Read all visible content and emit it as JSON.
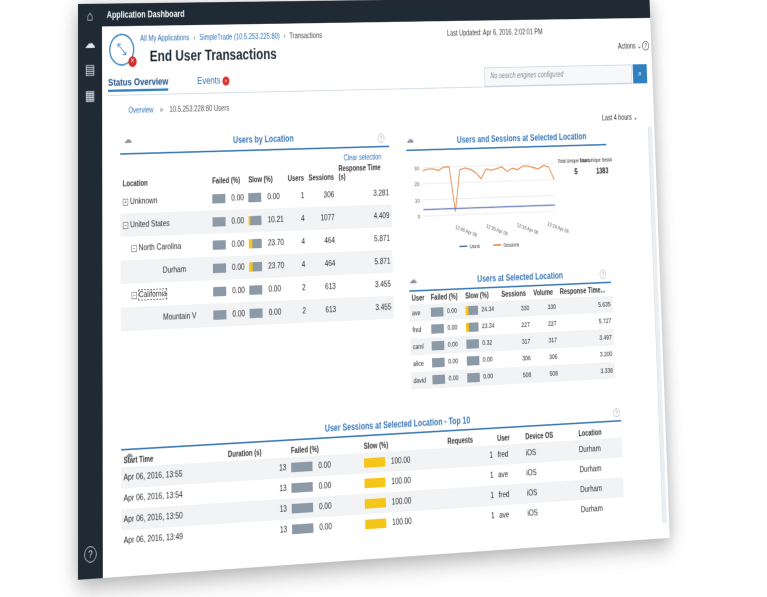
{
  "app": {
    "title": "Application Dashboard"
  },
  "nav": [
    {
      "icon": "home-icon",
      "glyph": "⌂"
    },
    {
      "icon": "cloud-check-icon",
      "glyph": "☁"
    },
    {
      "icon": "document-icon",
      "glyph": "▤"
    },
    {
      "icon": "calendar-grid-icon",
      "glyph": "▦"
    }
  ],
  "help_glyph": "?",
  "header": {
    "breadcrumb": [
      "All My Applications",
      "SimpleTrade (10.5.253.225:80)",
      "Transactions"
    ],
    "breadcrumb_sep": "›",
    "title": "End User Transactions",
    "last_updated": "Last Updated: Apr 6, 2016, 2:02:01 PM",
    "actions": "Actions ⌄"
  },
  "tabs": [
    {
      "label": "Status Overview",
      "active": true
    },
    {
      "label": "Events",
      "badge": "×"
    }
  ],
  "search": {
    "placeholder": "No search engines configured"
  },
  "overview": {
    "link": "Overview",
    "sep": "»",
    "current": "10.5.253.228:80 Users"
  },
  "time_range": "Last 4 hours ⌄",
  "users_by_location": {
    "title": "Users by Location",
    "clear": "Clear selection",
    "columns": [
      "Location",
      "Failed (%)",
      "Slow (%)",
      "Users",
      "Sessions",
      "Response Time (s)"
    ],
    "rows": [
      {
        "name": "Unknown",
        "tree": "+",
        "indent": 0,
        "failed": "0.00",
        "slow": "0.00",
        "slow_frac": 0,
        "users": "1",
        "sessions": "306",
        "resp": "3.281",
        "dotted": false
      },
      {
        "name": "United States",
        "tree": "−",
        "indent": 0,
        "failed": "0.00",
        "slow": "10.21",
        "slow_frac": 0.1021,
        "users": "4",
        "sessions": "1077",
        "resp": "4.409",
        "dotted": false
      },
      {
        "name": "North Carolina",
        "tree": "−",
        "indent": 1,
        "failed": "0.00",
        "slow": "23.70",
        "slow_frac": 0.237,
        "users": "4",
        "sessions": "464",
        "resp": "5.871",
        "dotted": false
      },
      {
        "name": "Durham",
        "tree": "",
        "indent": 2,
        "failed": "0.00",
        "slow": "23.70",
        "slow_frac": 0.237,
        "users": "4",
        "sessions": "464",
        "resp": "5.871",
        "dotted": false
      },
      {
        "name": "California",
        "tree": "−",
        "indent": 1,
        "failed": "0.00",
        "slow": "0.00",
        "slow_frac": 0,
        "users": "2",
        "sessions": "613",
        "resp": "3.455",
        "dotted": true
      },
      {
        "name": "Mountain V",
        "tree": "",
        "indent": 2,
        "failed": "0.00",
        "slow": "0.00",
        "slow_frac": 0,
        "users": "2",
        "sessions": "613",
        "resp": "3.455",
        "dotted": false
      }
    ]
  },
  "users_sessions_chart": {
    "title": "Users and Sessions at Selected Location",
    "stat_users_label": "Total Unique Users",
    "stat_users_value": "5",
    "stat_sessions_label": "Total Unique Sessions",
    "stat_sessions_value": "1383",
    "legend": [
      "Users",
      "Sessions"
    ]
  },
  "chart_data": {
    "type": "line",
    "x": [
      "12:40",
      "12:44",
      "12:48",
      "12:52",
      "12:56",
      "13:00",
      "13:04",
      "13:08",
      "13:12",
      "13:16",
      "13:20",
      "13:24",
      "13:28",
      "13:32",
      "13:36",
      "13:40",
      "13:44",
      "13:48",
      "13:52",
      "13:56",
      "14:00",
      "14:04",
      "14:08",
      "14:12",
      "14:16",
      "14:20"
    ],
    "xticks": [
      "12:45 Apr 06",
      "12:30 Apr 06",
      "12:15 Apr 06",
      "12:16 Apr 06"
    ],
    "yticks": [
      "30",
      "20",
      "10",
      "0"
    ],
    "ylim": [
      0,
      35
    ],
    "series": [
      {
        "name": "Sessions",
        "color": "#e8803a",
        "values": [
          28,
          29,
          29,
          28,
          30,
          30,
          2,
          28,
          29,
          28,
          26,
          22,
          28,
          27,
          28,
          29,
          26,
          28,
          27,
          29,
          29,
          28,
          27,
          29,
          28,
          20
        ]
      },
      {
        "name": "Users",
        "color": "#5b6fb4",
        "values": [
          4,
          4,
          4,
          4,
          4,
          4,
          4,
          4,
          4,
          4,
          4,
          4,
          4,
          4,
          4,
          4,
          4,
          4,
          4,
          4,
          4,
          4,
          4,
          4,
          4,
          4
        ]
      }
    ]
  },
  "users_at_location": {
    "title": "Users at Selected Location",
    "columns": [
      "User",
      "Failed (%)",
      "Slow (%)",
      "Sessions",
      "Volume",
      "Response Time..."
    ],
    "rows": [
      {
        "user": "ave",
        "failed": "0.00",
        "slow": "24.34",
        "slow_frac": 0.2434,
        "sessions": "330",
        "volume": "330",
        "resp": "5.635"
      },
      {
        "user": "fred",
        "failed": "0.00",
        "slow": "23.34",
        "slow_frac": 0.2334,
        "sessions": "227",
        "volume": "227",
        "resp": "5.727"
      },
      {
        "user": "caml",
        "failed": "0.00",
        "slow": "0.32",
        "slow_frac": 0.0032,
        "sessions": "317",
        "volume": "317",
        "resp": "3.497"
      },
      {
        "user": "alice",
        "failed": "0.00",
        "slow": "0.00",
        "slow_frac": 0,
        "sessions": "306",
        "volume": "306",
        "resp": "3.200"
      },
      {
        "user": "david",
        "failed": "0.00",
        "slow": "0.00",
        "slow_frac": 0,
        "sessions": "508",
        "volume": "508",
        "resp": "3.338"
      }
    ]
  },
  "top_sessions": {
    "title": "User Sessions at Selected Location - Top 10",
    "columns": [
      "Start Time",
      "Duration (s)",
      "Failed (%)",
      "Slow (%)",
      "Requests",
      "User",
      "Device OS",
      "Location"
    ],
    "rows": [
      {
        "start": "Apr 06, 2016, 13:55",
        "duration": "13",
        "failed": "0.00",
        "slow": "100.00",
        "requests": "1",
        "user": "fred",
        "os": "iOS",
        "location": "Durham"
      },
      {
        "start": "Apr 06, 2016, 13:54",
        "duration": "13",
        "failed": "0.00",
        "slow": "100.00",
        "requests": "1",
        "user": "ave",
        "os": "iOS",
        "location": "Durham"
      },
      {
        "start": "Apr 06, 2016, 13:50",
        "duration": "13",
        "failed": "0.00",
        "slow": "100.00",
        "requests": "1",
        "user": "fred",
        "os": "iOS",
        "location": "Durham"
      },
      {
        "start": "Apr 06, 2016, 13:49",
        "duration": "13",
        "failed": "0.00",
        "slow": "100.00",
        "requests": "1",
        "user": "ave",
        "os": "iOS",
        "location": "Durham"
      }
    ]
  },
  "colors": {
    "sidebar": "#1f2a35",
    "accent": "#2f7fc1",
    "slow": "#f5c518",
    "bar": "#8c99a6",
    "error": "#d2322d"
  }
}
